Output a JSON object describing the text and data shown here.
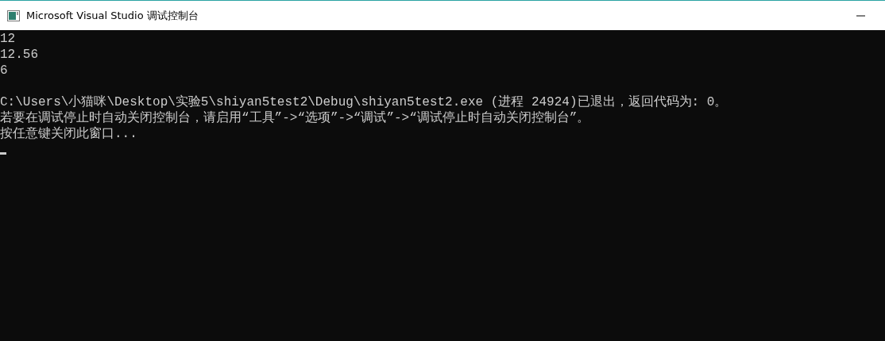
{
  "window": {
    "title": "Microsoft Visual Studio 调试控制台"
  },
  "console": {
    "blocks": [
      [
        "12",
        "12.56",
        "6"
      ],
      [
        "C:\\Users\\小猫咪\\Desktop\\实验5\\shiyan5test2\\Debug\\shiyan5test2.exe (进程 24924)已退出，返回代码为: 0。",
        "若要在调试停止时自动关闭控制台，请启用“工具”->“选项”->“调试”->“调试停止时自动关闭控制台”。",
        "按任意键关闭此窗口..."
      ]
    ]
  }
}
